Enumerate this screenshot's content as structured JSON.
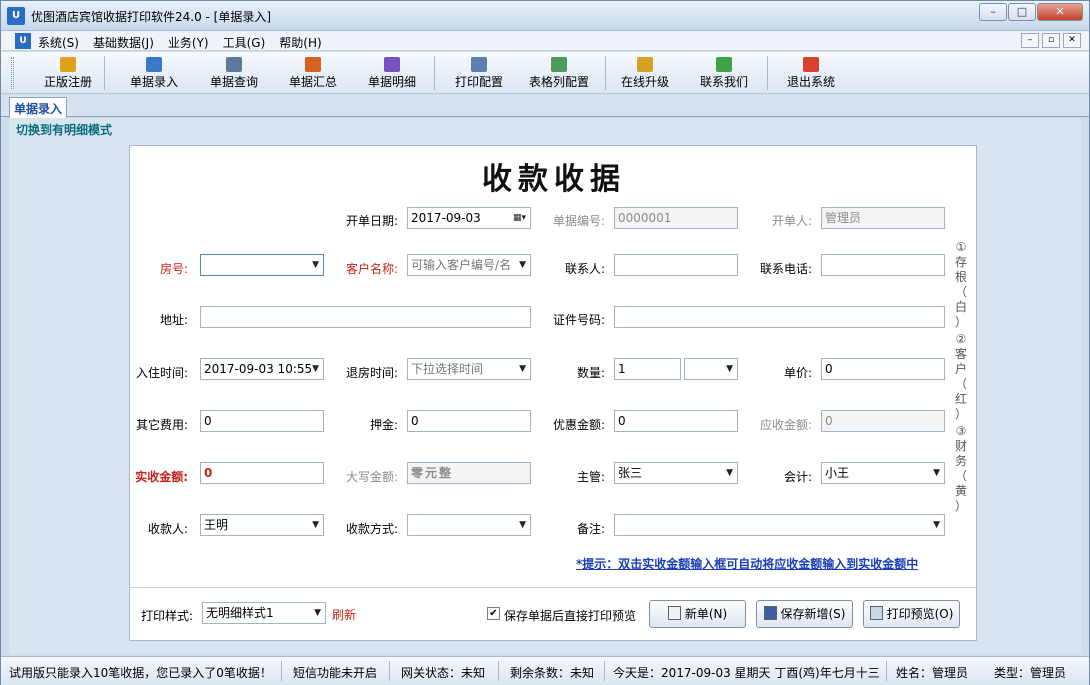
{
  "window": {
    "title": "优图酒店宾馆收据打印软件24.0 - [单据录入]",
    "icon_text": "U"
  },
  "menu": [
    "系统(S)",
    "基础数据(J)",
    "业务(Y)",
    "工具(G)",
    "帮助(H)"
  ],
  "toolbar": [
    {
      "label": "正版注册",
      "icon": "lock-icon",
      "color": "#e0a21e"
    },
    {
      "label": "单据录入",
      "icon": "edit-icon",
      "color": "#3a78c9"
    },
    {
      "label": "单据查询",
      "icon": "search-doc-icon",
      "color": "#5c7b9a"
    },
    {
      "label": "单据汇总",
      "icon": "bar-chart-icon",
      "color": "#d5621f"
    },
    {
      "label": "单据明细",
      "icon": "column-chart-icon",
      "color": "#7a4fc0"
    },
    {
      "label": "打印配置",
      "icon": "printer-config-icon",
      "color": "#5a7fb0"
    },
    {
      "label": "表格列配置",
      "icon": "table-config-icon",
      "color": "#4b9b5a"
    },
    {
      "label": "在线升级",
      "icon": "upgrade-icon",
      "color": "#d6a11f"
    },
    {
      "label": "联系我们",
      "icon": "contact-icon",
      "color": "#3fa346"
    },
    {
      "label": "退出系统",
      "icon": "exit-icon",
      "color": "#d9412d"
    }
  ],
  "tab": "单据录入",
  "switch_mode": "切换到有明细模式",
  "form": {
    "title": "收款收据",
    "open_date_label": "开单日期:",
    "open_date": "2017-09-03",
    "doc_no_label": "单据编号:",
    "doc_no": "0000001",
    "creator_label": "开单人:",
    "creator": "管理员",
    "room_label": "房号:",
    "room": "",
    "customer_label": "客户名称:",
    "customer_placeholder": "可输入客户编号/名",
    "contact_label": "联系人:",
    "contact": "",
    "phone_label": "联系电话:",
    "phone": "",
    "address_label": "地址:",
    "address": "",
    "id_label": "证件号码:",
    "id_no": "",
    "checkin_label": "入住时间:",
    "checkin": "2017-09-03 10:55",
    "checkout_label": "退房时间:",
    "checkout_placeholder": "下拉选择时间",
    "qty_label": "数量:",
    "qty": "1",
    "qty_unit": "",
    "price_label": "单价:",
    "price": "0",
    "other_fee_label": "其它费用:",
    "other_fee": "0",
    "deposit_label": "押金:",
    "deposit": "0",
    "discount_label": "优惠金额:",
    "discount": "0",
    "receivable_label": "应收金额:",
    "receivable": "0",
    "paid_label": "实收金额:",
    "paid": "0",
    "capital_label": "大写金额:",
    "capital": "零元整",
    "supervisor_label": "主管:",
    "supervisor": "张三",
    "accountant_label": "会计:",
    "accountant": "小王",
    "payee_label": "收款人:",
    "payee": "王明",
    "pay_method_label": "收款方式:",
    "pay_method": "",
    "remark_label": "备注:",
    "remark": "",
    "tip": "*提示：双击实收金额输入框可自动将应收金额输入到实收金额中",
    "side_copies": [
      "①存根（白）",
      "②客户（红）",
      "③财务（黄）"
    ]
  },
  "footer": {
    "print_style_label": "打印样式:",
    "print_style": "无明细样式1",
    "refresh": "刷新",
    "preview_after_save_label": "保存单据后直接打印预览",
    "preview_after_save_checked": true,
    "new_button": "新单(N)",
    "save_new_button": "保存新增(S)",
    "print_preview_button": "打印预览(O)"
  },
  "status": {
    "trial": "试用版只能录入10笔收据，您已录入了0笔收据！",
    "sms": "短信功能未开启",
    "gateway": "网关状态：未知",
    "remaining": "剩余条数：未知",
    "today": "今天是：2017-09-03 星期天 丁酉(鸡)年七月十三",
    "user": "姓名：管理员",
    "role": "类型：管理员"
  }
}
